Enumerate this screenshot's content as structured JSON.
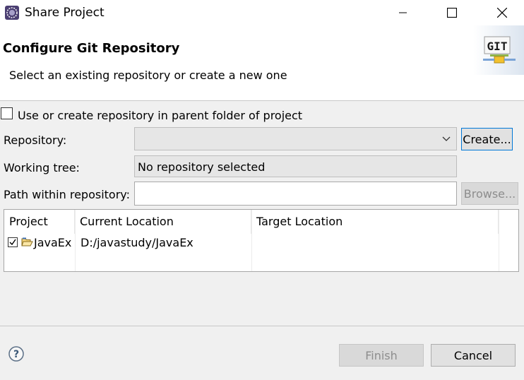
{
  "window": {
    "title": "Share Project",
    "controls": [
      "minimize-icon",
      "maximize-icon",
      "close-icon"
    ]
  },
  "banner": {
    "title": "Configure Git Repository",
    "description": "Select an existing repository or create a new one",
    "logo_text": "GIT"
  },
  "form": {
    "parent_folder_checkbox": {
      "label": "Use or create repository in parent folder of project",
      "checked": false
    },
    "repository": {
      "label": "Repository:",
      "value": "",
      "create_label": "Create..."
    },
    "working_tree": {
      "label": "Working tree:",
      "value": "No repository selected"
    },
    "path_within_repository": {
      "label": "Path within repository:",
      "value": "",
      "browse_label": "Browse..."
    }
  },
  "table": {
    "columns": [
      "Project",
      "Current Location",
      "Target Location"
    ],
    "rows": [
      {
        "project": "JavaEx",
        "current_location": "D:/javastudy/JavaEx",
        "target_location": "",
        "checked": true
      }
    ]
  },
  "footer": {
    "help_icon": "help-icon",
    "finish_label": "Finish",
    "cancel_label": "Cancel"
  },
  "colors": {
    "accent": "#0078d7",
    "banner_bg": "#ffffff",
    "dialog_bg": "#f0f0f0"
  }
}
